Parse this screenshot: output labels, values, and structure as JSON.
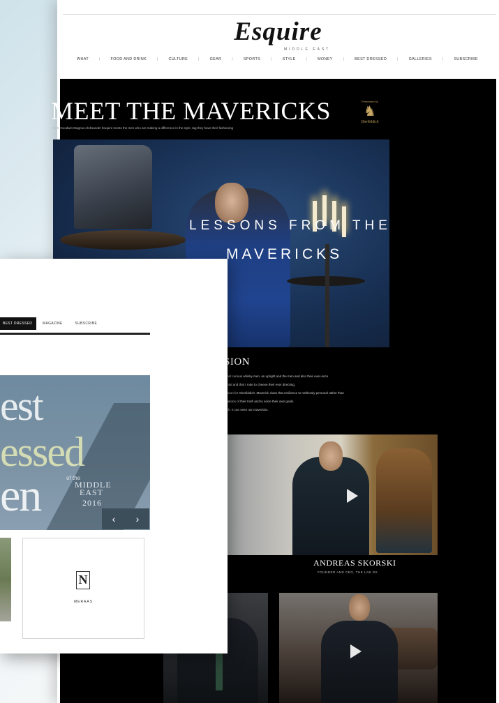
{
  "main_page": {
    "logo": "Esquire",
    "logo_sub": "MIDDLE EAST",
    "nav": [
      "WHAT",
      "FOOD AND DRINK",
      "CULTURE",
      "GEAR",
      "SPORTS",
      "STYLE",
      "MONEY",
      "BEST DRESSED",
      "GALLERIES",
      "SUBSCRIBE"
    ],
    "hero_title": "MEET THE MAVERICKS",
    "hero_subtitle": "Rolls Goodwin Magnus Aleksander Esquire meets the men who are making a difference in the style, tag they have their fashioning",
    "sponsor": {
      "presented": "Presented by",
      "brand": "Glenfiddich"
    },
    "overlay_line1": "LESSONS FROM THE",
    "overlay_line2": "MAVERICKS",
    "mission_title": "THE MISSION",
    "mission_paragraphs": [
      "Since Glenfiddich has known the world's most curious whisky men, an upright and the men and also their ever-once",
      "at ensuring Nature their results. The horizontal and that I rode to cheese their ever directing.",
      "Finest learns from the school questions mission for Glenfiddich. Maverick class that resilience to ruthlessly personal rather than",
      "in challenge the ever power profile in foundations of their truth and to seize their own goals.",
      "Are the real men of the mentor in Glenfiddich. It can seen our mavericks."
    ],
    "card_name": "ANDREAS SKORSKI",
    "card_role": "FOUNDER AND CEO, THE LAB OS"
  },
  "overlay_window": {
    "tabs": [
      "BEST DRESSED",
      "MAGAZINE",
      "SUBSCRIBE"
    ],
    "banner": {
      "line1": "est",
      "line2": "essed",
      "line3": "en",
      "of_the": "of the",
      "middle_east": "MIDDLE EAST",
      "year": "2016",
      "prev": "‹",
      "next": "›"
    },
    "thumb_logo": "MERAAS"
  },
  "colors": {
    "page_bg": "#ffffff",
    "panel_bg": "#000000",
    "banner_bg": "#7b92a4",
    "banner_control": "#3d4e5b"
  }
}
